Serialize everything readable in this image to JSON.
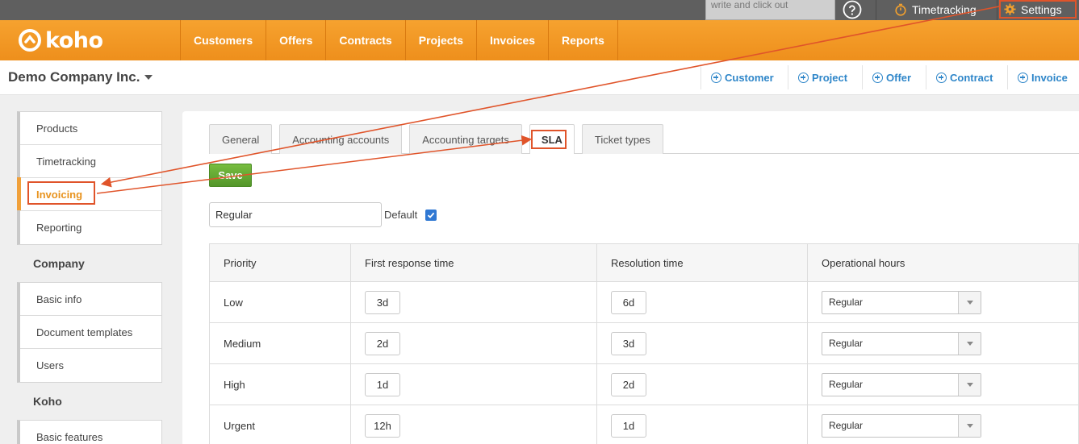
{
  "topbar": {
    "search_text": "write and click out",
    "timetracking_label": "Timetracking",
    "settings_label": "Settings"
  },
  "brand": {
    "logo_text": "koho"
  },
  "nav": {
    "items": [
      "Customers",
      "Offers",
      "Contracts",
      "Projects",
      "Invoices",
      "Reports"
    ]
  },
  "header": {
    "company": "Demo Company Inc.",
    "quick_actions": [
      "Customer",
      "Project",
      "Offer",
      "Contract",
      "Invoice"
    ]
  },
  "sidebar": {
    "group1": [
      "Products",
      "Timetracking",
      "Invoicing",
      "Reporting"
    ],
    "company_heading": "Company",
    "group2": [
      "Basic info",
      "Document templates",
      "Users"
    ],
    "koho_heading": "Koho",
    "group3": [
      "Basic features"
    ]
  },
  "tabs": [
    "General",
    "Accounting accounts",
    "Accounting targets",
    "SLA",
    "Ticket types"
  ],
  "save_label": "Save",
  "sla_name": "Regular",
  "default_label": "Default",
  "default_checked": true,
  "table": {
    "headers": [
      "Priority",
      "First response time",
      "Resolution time",
      "Operational hours"
    ],
    "rows": [
      {
        "priority": "Low",
        "first": "3d",
        "resolution": "6d",
        "hours": "Regular"
      },
      {
        "priority": "Medium",
        "first": "2d",
        "resolution": "3d",
        "hours": "Regular"
      },
      {
        "priority": "High",
        "first": "1d",
        "resolution": "2d",
        "hours": "Regular"
      },
      {
        "priority": "Urgent",
        "first": "12h",
        "resolution": "1d",
        "hours": "Regular"
      }
    ]
  },
  "colors": {
    "brand_orange": "#f29a25",
    "annotation_red": "#e0542a",
    "link_blue": "#2e86c9",
    "save_green": "#5ea231"
  }
}
